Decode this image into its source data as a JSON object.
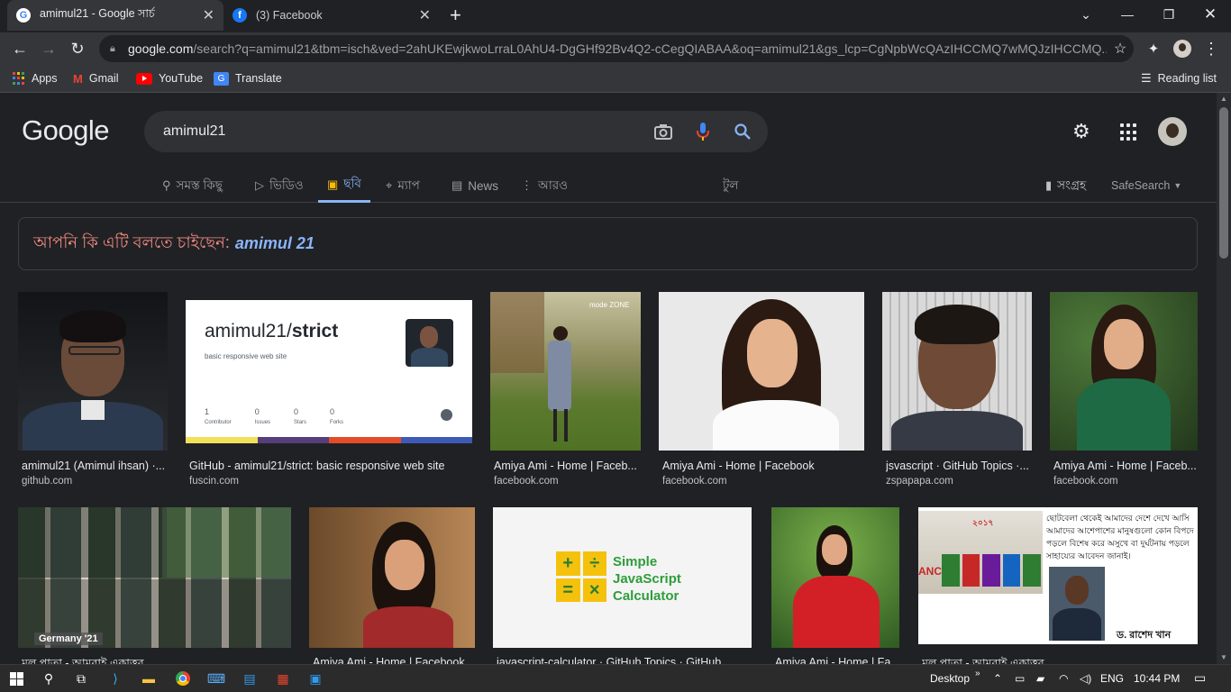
{
  "browser": {
    "tabs": [
      {
        "title": "amimul21 - Google সার্চ",
        "favicon": "google-icon",
        "active": true
      },
      {
        "title": "(3) Facebook",
        "favicon": "facebook-icon",
        "active": false
      }
    ],
    "new_tab_label": "+",
    "address": {
      "host": "google.com",
      "path": "/search?q=amimul21&tbm=isch&ved=2ahUKEwjkwoLrraL0AhU4-DgGHf92Bv4Q2-cCegQIABAA&oq=amimul21&gs_lcp=CgNpbWcQAzIHCCMQ7wMQJzIHCCMQ..."
    },
    "bookmarks": [
      {
        "label": "Apps",
        "icon": "apps-grid-icon"
      },
      {
        "label": "Gmail",
        "icon": "gmail-icon"
      },
      {
        "label": "YouTube",
        "icon": "youtube-icon"
      },
      {
        "label": "Translate",
        "icon": "translate-icon"
      }
    ],
    "reading_list": "Reading list"
  },
  "google": {
    "logo": "Google",
    "query": "amimul21",
    "tabs": [
      {
        "label": "সমস্ত কিছু",
        "icon": "search-icon",
        "selected": false
      },
      {
        "label": "ভিডিও",
        "icon": "video-icon",
        "selected": false
      },
      {
        "label": "ছবি",
        "icon": "image-icon",
        "selected": true
      },
      {
        "label": "ম্যাপ",
        "icon": "map-pin-icon",
        "selected": false
      },
      {
        "label": "News",
        "icon": "news-icon",
        "selected": false
      },
      {
        "label": "আরও",
        "icon": "more-vert-icon",
        "selected": false
      }
    ],
    "tools_label": "টুল",
    "collections_label": "সংগ্রহ",
    "safesearch_label": "SafeSearch",
    "did_you_mean": {
      "prefix": "আপনি কি এটি বলতে চাইছেন:",
      "suggestion": "amimul 21"
    },
    "results_row1": [
      {
        "caption": "amimul21 (Amimul ihsan) ·...",
        "source": "github.com"
      },
      {
        "caption": "GitHub - amimul21/strict: basic responsive web site",
        "source": "fuscin.com"
      },
      {
        "caption": "Amiya Ami - Home | Faceb...",
        "source": "facebook.com"
      },
      {
        "caption": "Amiya Ami - Home | Facebook",
        "source": "facebook.com"
      },
      {
        "caption": "jsvascript · GitHub Topics ·...",
        "source": "zspapapa.com"
      },
      {
        "caption": "Amiya Ami - Home | Faceb...",
        "source": "facebook.com"
      }
    ],
    "results_row2": [
      {
        "caption": "মূল পাতা - আমরাই একাত্তর"
      },
      {
        "caption": "Amiya Ami - Home | Facebook"
      },
      {
        "caption": "javascript-calculator · GitHub Topics · GitHub"
      },
      {
        "caption": "Amiya Ami - Home | Fa..."
      },
      {
        "caption": "মূল পাতা - আমরাই একাত্তর"
      }
    ],
    "github_card": {
      "repo_user": "amimul21/",
      "repo_name": "strict",
      "desc": "basic responsive web site",
      "stats": [
        {
          "n": "1",
          "label": "Contributor"
        },
        {
          "n": "0",
          "label": "Issues"
        },
        {
          "n": "0",
          "label": "Stars"
        },
        {
          "n": "0",
          "label": "Forks"
        }
      ]
    },
    "mode_zone_badge": "mode ZONE",
    "germany_caption": "Germany '21",
    "calc_card": {
      "line1": "Simple",
      "line2": "JavaScript",
      "line3": "Calculator"
    },
    "collage_text": "ছোটবেলা থেকেই আমাদের দেশে দেখে আসি আমাদের আশেপাশের মানুষগুলো কোন বিপদে পড়লে বিশেষ করে অসুখে বা দুর্ঘটনায় পড়লে সাহায্যের আবেদন জানাই।",
    "collage_name": "ড. রাশেদ খান",
    "collage_year": "২০১৭",
    "collage_side": "ANCE"
  },
  "taskbar": {
    "desktop_label": "Desktop",
    "lang": "ENG",
    "time": "10:44 PM"
  }
}
